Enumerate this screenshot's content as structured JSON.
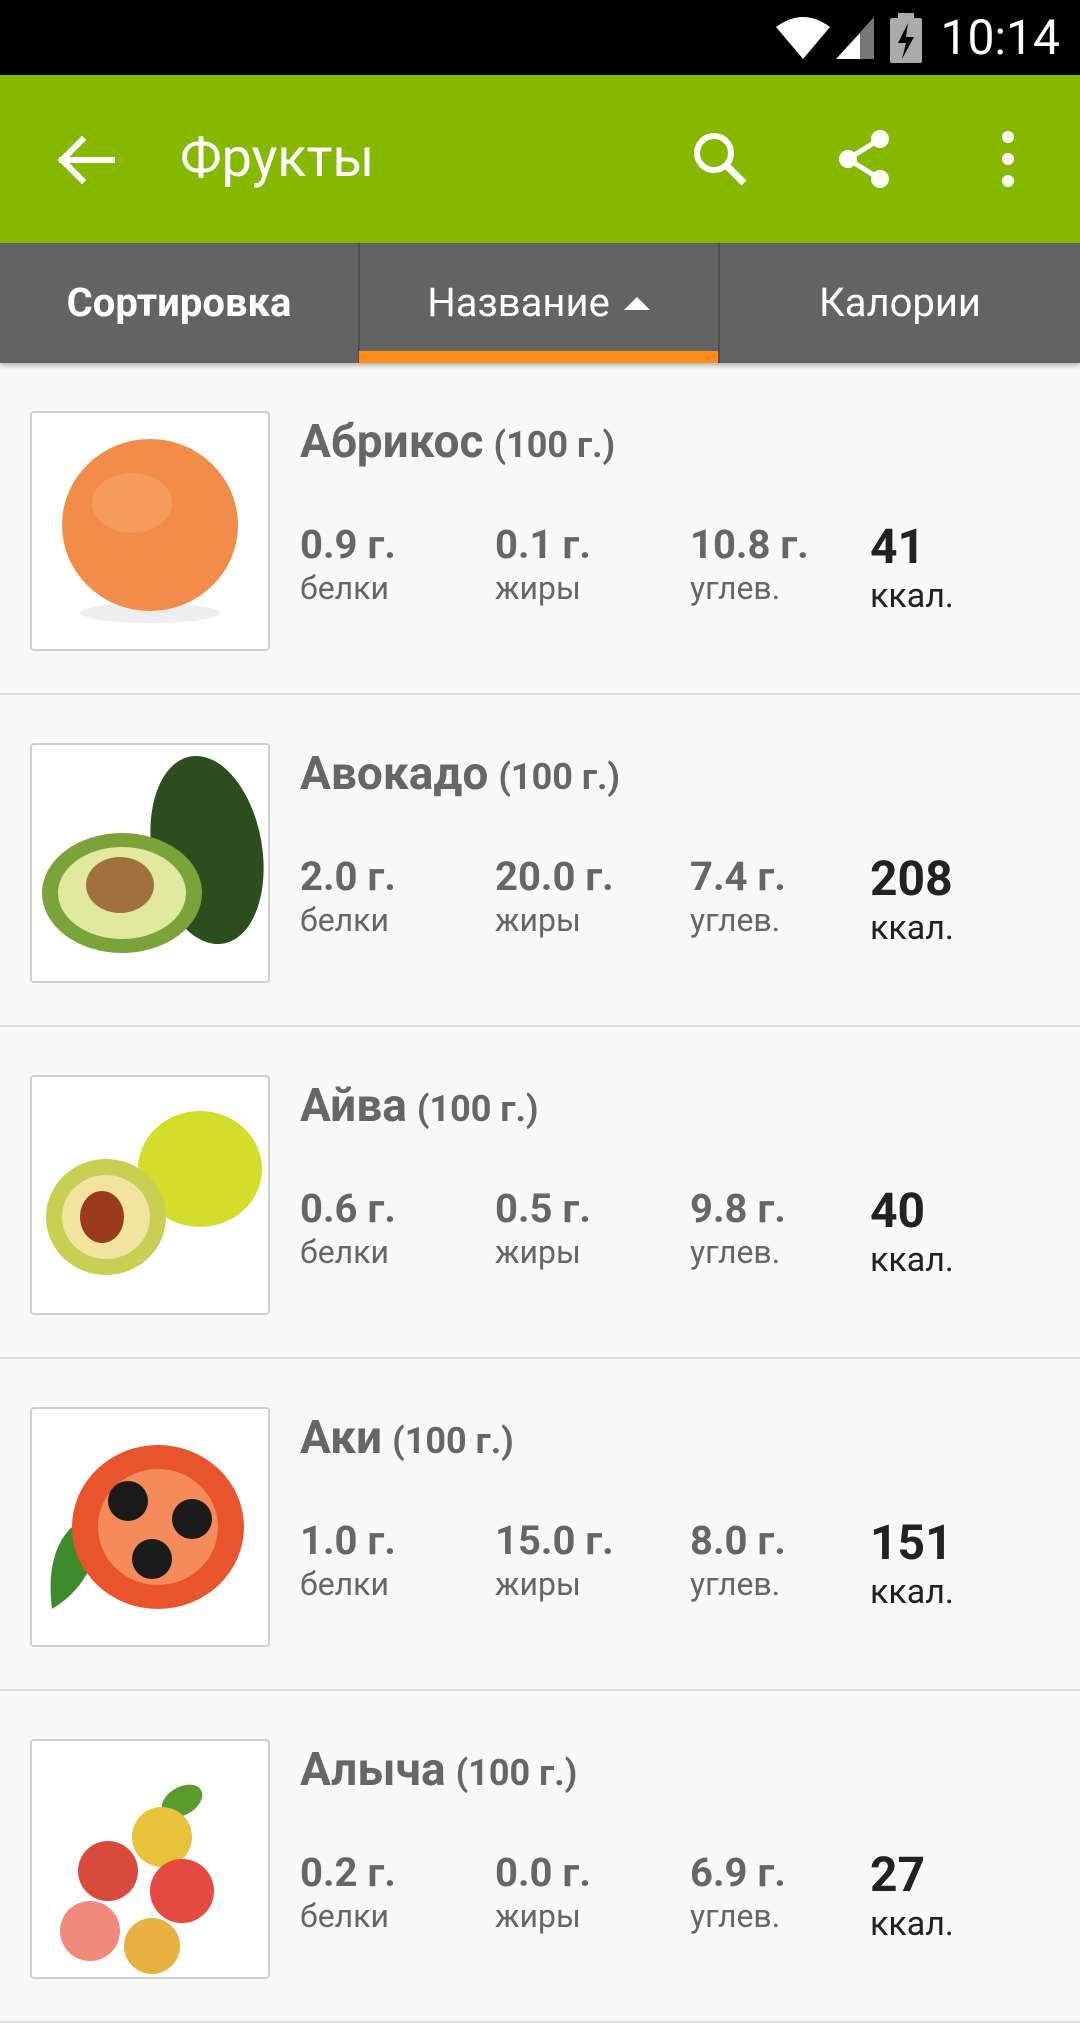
{
  "status_bar": {
    "time": "10:14",
    "icons": [
      "wifi-icon",
      "cell-signal-icon",
      "battery-charging-icon"
    ]
  },
  "app_bar": {
    "title": "Фрукты",
    "back_icon": "arrow-left-icon",
    "actions": [
      "search-icon",
      "share-icon",
      "more-vert-icon"
    ],
    "color": "#86b800"
  },
  "tabs": {
    "sort_label": "Сортировка",
    "name_label": "Название",
    "calories_label": "Калории",
    "active": "Название",
    "active_underline_color": "#ff8c1a"
  },
  "labels": {
    "protein": "белки",
    "fat": "жиры",
    "carbs": "углев.",
    "kcal": "ккал."
  },
  "items": [
    {
      "name": "Абрикос",
      "portion": "(100 г.)",
      "protein": "0.9 г.",
      "fat": "0.1 г.",
      "carbs": "10.8 г.",
      "kcal": "41",
      "image": "apricot"
    },
    {
      "name": "Авокадо",
      "portion": "(100 г.)",
      "protein": "2.0 г.",
      "fat": "20.0 г.",
      "carbs": "7.4 г.",
      "kcal": "208",
      "image": "avocado"
    },
    {
      "name": "Айва",
      "portion": "(100 г.)",
      "protein": "0.6 г.",
      "fat": "0.5 г.",
      "carbs": "9.8 г.",
      "kcal": "40",
      "image": "quince"
    },
    {
      "name": "Аки",
      "portion": "(100 г.)",
      "protein": "1.0 г.",
      "fat": "15.0 г.",
      "carbs": "8.0 г.",
      "kcal": "151",
      "image": "ackee"
    },
    {
      "name": "Алыча",
      "portion": "(100 г.)",
      "protein": "0.2 г.",
      "fat": "0.0 г.",
      "carbs": "6.9 г.",
      "kcal": "27",
      "image": "cherry-plum"
    }
  ]
}
